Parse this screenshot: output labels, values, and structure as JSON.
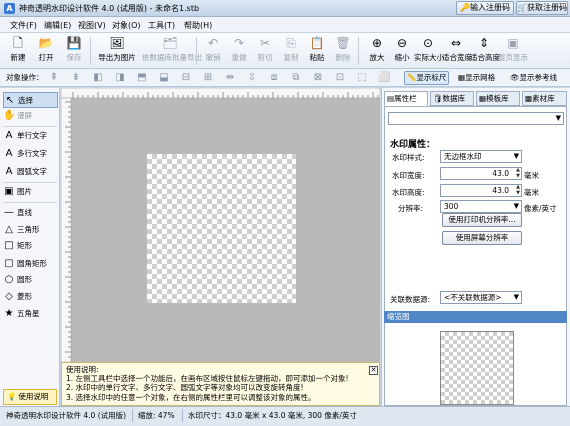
{
  "title": {
    "app": "神奇透明水印设计软件 4.0 (试用版) - 未命名1.stb",
    "logo_char": "A"
  },
  "window_controls": {
    "register": "输入注册码",
    "get_code": "获取注册码",
    "close": "✕"
  },
  "menu": [
    "文件(F)",
    "编辑(E)",
    "视图(V)",
    "对象(O)",
    "工具(T)",
    "帮助(H)"
  ],
  "toolbar": [
    {
      "label": "新建",
      "icon": "new-file-icon",
      "glyph": "🗋",
      "enabled": true
    },
    {
      "label": "打开",
      "icon": "open-folder-icon",
      "glyph": "📂",
      "enabled": true
    },
    {
      "label": "保存",
      "icon": "save-icon",
      "glyph": "💾",
      "enabled": false
    },
    {
      "label": "导出为图片",
      "icon": "export-image-icon",
      "glyph": "🖼",
      "enabled": true
    },
    {
      "label": "依数据库批量导出",
      "icon": "batch-export-icon",
      "glyph": "🗂",
      "enabled": false
    },
    {
      "label": "撤销",
      "icon": "undo-icon",
      "glyph": "↶",
      "enabled": false
    },
    {
      "label": "重做",
      "icon": "redo-icon",
      "glyph": "↷",
      "enabled": false
    },
    {
      "label": "剪切",
      "icon": "cut-icon",
      "glyph": "✂",
      "enabled": false
    },
    {
      "label": "复制",
      "icon": "copy-icon",
      "glyph": "⎘",
      "enabled": false
    },
    {
      "label": "粘贴",
      "icon": "paste-icon",
      "glyph": "📋",
      "enabled": true
    },
    {
      "label": "删除",
      "icon": "delete-icon",
      "glyph": "🗑",
      "enabled": false
    },
    {
      "label": "放大",
      "icon": "zoom-in-icon",
      "glyph": "⊕",
      "enabled": true
    },
    {
      "label": "缩小",
      "icon": "zoom-out-icon",
      "glyph": "⊖",
      "enabled": true
    },
    {
      "label": "实际大小",
      "icon": "actual-size-icon",
      "glyph": "⊙",
      "enabled": true
    },
    {
      "label": "适合宽度",
      "icon": "fit-width-icon",
      "glyph": "⇔",
      "enabled": true
    },
    {
      "label": "适合高度",
      "icon": "fit-height-icon",
      "glyph": "⇕",
      "enabled": true
    },
    {
      "label": "整页显示",
      "icon": "full-page-icon",
      "glyph": "▣",
      "enabled": false
    }
  ],
  "toolbar2": {
    "label": "对象操作：",
    "show_ruler": "显示标尺",
    "show_grid": "显示网格",
    "show_guides": "显示参考线"
  },
  "tools": [
    {
      "label": "选择",
      "glyph": "↖",
      "icon": "select-arrow-icon"
    },
    {
      "label": "漫屏",
      "glyph": "✋",
      "icon": "pan-hand-icon"
    },
    {
      "label": "单行文字",
      "glyph": "A",
      "icon": "single-text-icon"
    },
    {
      "label": "多行文字",
      "glyph": "A",
      "icon": "multi-text-icon"
    },
    {
      "label": "圆弧文字",
      "glyph": "A",
      "icon": "arc-text-icon"
    },
    {
      "label": "图片",
      "glyph": "▣",
      "icon": "image-icon"
    },
    {
      "label": "直线",
      "glyph": "—",
      "icon": "line-icon"
    },
    {
      "label": "三角形",
      "glyph": "△",
      "icon": "triangle-icon"
    },
    {
      "label": "矩形",
      "glyph": "□",
      "icon": "rectangle-icon"
    },
    {
      "label": "圆角矩形",
      "glyph": "▢",
      "icon": "rounded-rect-icon"
    },
    {
      "label": "圆形",
      "glyph": "○",
      "icon": "circle-icon"
    },
    {
      "label": "菱形",
      "glyph": "◇",
      "icon": "diamond-icon"
    },
    {
      "label": "五角星",
      "glyph": "★",
      "icon": "star-icon"
    }
  ],
  "help_button": "使用说明",
  "hint": {
    "title": "使用说明:",
    "lines": [
      "1. 左侧工具栏中选择一个功能后，在画布区域按住鼠标左键拖动，即可添加一个对象!",
      "2. 水印中的单行文字、多行文字、圆弧文字等对象均可以改变旋转角度!",
      "3. 选择水印中的任意一个对象，在右侧的属性栏里可以调整该对象的属性。"
    ]
  },
  "right_tabs": [
    "属性栏",
    "数据库",
    "模板库",
    "素材库"
  ],
  "props": {
    "heading": "水印属性：",
    "style_label": "水印样式:",
    "style_value": "无边框水印",
    "width_label": "水印宽度:",
    "width_value": "43.0",
    "width_unit": "毫米",
    "height_label": "水印高度:",
    "height_value": "43.0",
    "height_unit": "毫米",
    "dpi_label": "分辨率:",
    "dpi_value": "300",
    "dpi_unit": "像素/英寸",
    "btn_printer_dpi": "使用打印机分辨率...",
    "btn_screen_dpi": "使用屏幕分辨率",
    "db_label": "关联数据源:",
    "db_value": "<不关联数据源>"
  },
  "preview_title": "缩览图",
  "status": {
    "app": "神奇透明水印设计软件 4.0 (试用版)",
    "zoom": "缩放: 47%",
    "size": "水印尺寸：43.0 毫米 x 43.0 毫米, 300 像素/英寸"
  }
}
